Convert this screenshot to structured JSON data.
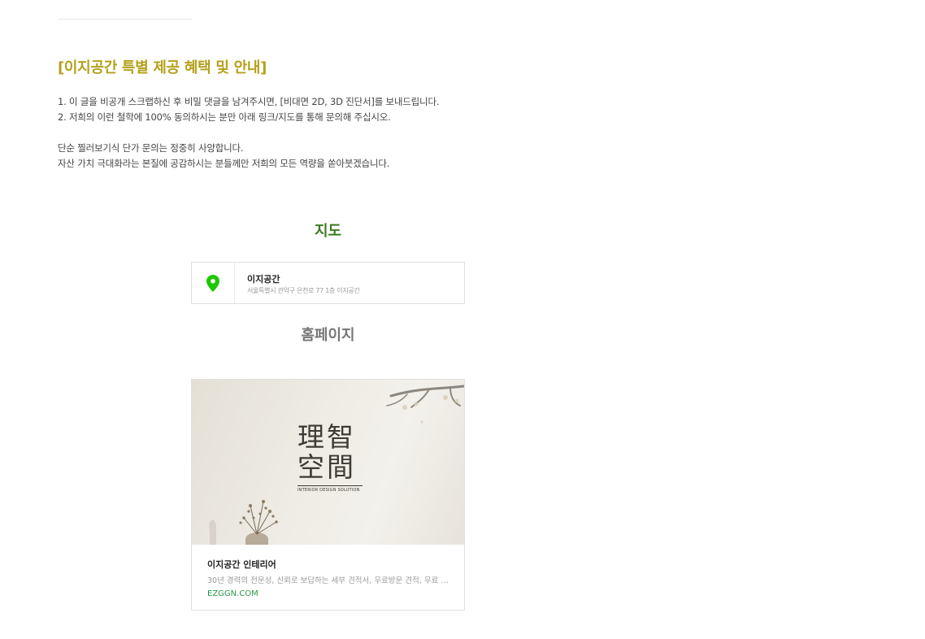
{
  "heading": "[이지공간 특별 제공 혜택 및 안내]",
  "paragraphs": {
    "line1": "1. 이 글을 비공개 스크랩하신 후 비밀 댓글을 남겨주시면, [비대면 2D, 3D 진단서]를 보내드립니다.",
    "line2": "2. 저희의 이런 철학에 100% 동의하시는 분만 아래 링크/지도를 통해 문의해 주십시오.",
    "line3": "단순 찔러보기식 단가 문의는 정중히 사양합니다.",
    "line4": "자산 가치 극대화라는 본질에 공감하시는 분들께만 저희의 모든 역량을 쏟아붓겠습니다."
  },
  "map_section": {
    "title": "지도",
    "place_name": "이지공간",
    "address": "서울특별시 관악구 은천로 77 1층 이지공간",
    "icon": "map-pin-icon",
    "pin_color": "#1ec800"
  },
  "homepage_section": {
    "title": "홈페이지",
    "card": {
      "logo_chars": [
        "理智",
        "空間"
      ],
      "logo_subtitle": "INTERIOR DESIGN SOLUTION",
      "title": "이지공간 인테리어",
      "description": "30년 경력의 전문성, 신뢰로 보답하는 세부 견적서, 무료방문 견적, 무료 …",
      "url": "EZGGN.COM"
    }
  },
  "colors": {
    "heading": "#b5a01a",
    "map_title": "#3d7a22",
    "url": "#2d9a48"
  }
}
